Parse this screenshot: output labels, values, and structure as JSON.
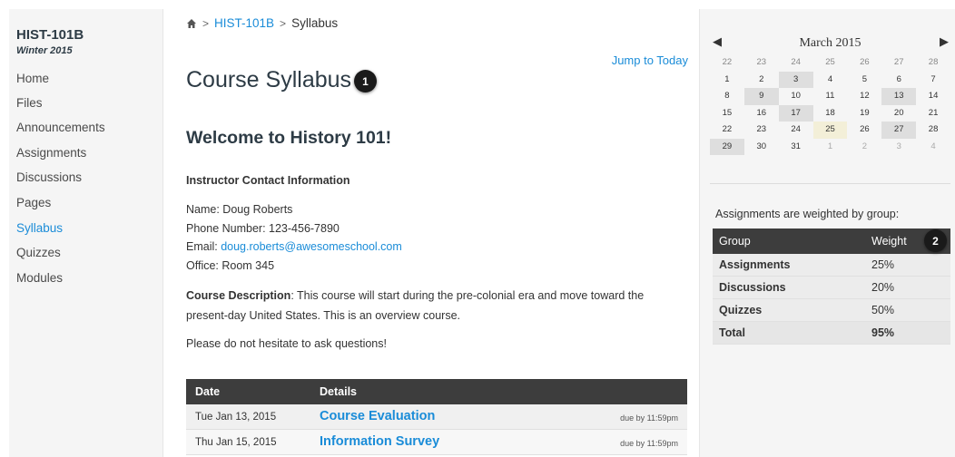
{
  "sidebar": {
    "course_code": "HIST-101B",
    "term": "Winter 2015",
    "items": [
      {
        "label": "Home",
        "active": false
      },
      {
        "label": "Files",
        "active": false
      },
      {
        "label": "Announcements",
        "active": false
      },
      {
        "label": "Assignments",
        "active": false
      },
      {
        "label": "Discussions",
        "active": false
      },
      {
        "label": "Pages",
        "active": false
      },
      {
        "label": "Syllabus",
        "active": true
      },
      {
        "label": "Quizzes",
        "active": false
      },
      {
        "label": "Modules",
        "active": false
      }
    ]
  },
  "breadcrumb": {
    "home_icon": "home-icon",
    "course": "HIST-101B",
    "current": "Syllabus"
  },
  "main": {
    "jump_to_today": "Jump to Today",
    "title": "Course Syllabus",
    "callout_1": "1",
    "welcome": "Welcome to History 101!",
    "contact_heading": "Instructor Contact Information",
    "name_line": "Name: Doug Roberts",
    "phone_line": "Phone Number: 123-456-7890",
    "email_prefix": "Email: ",
    "email": "doug.roberts@awesomeschool.com",
    "office_line": "Office: Room 345",
    "description_label": "Course Description",
    "description_line1": ": This course will start during the pre-colonial era and move toward the",
    "description_line2": "present-day United States. This is an overview course.",
    "hesitate": "Please do not hesitate to ask questions!"
  },
  "syllabus_table": {
    "headers": {
      "date": "Date",
      "details": "Details"
    },
    "rows": [
      {
        "date": "Tue Jan 13, 2015",
        "name": "Course Evaluation",
        "due": "due by 11:59pm"
      },
      {
        "date": "Thu Jan 15, 2015",
        "name": "Information Survey",
        "due": "due by 11:59pm"
      }
    ]
  },
  "calendar": {
    "month": "March 2015",
    "prev_icon": "chevron-left-icon",
    "next_icon": "chevron-right-icon",
    "header_row": [
      "22",
      "23",
      "24",
      "25",
      "26",
      "27",
      "28"
    ],
    "weeks": [
      [
        {
          "d": "1"
        },
        {
          "d": "2"
        },
        {
          "d": "3",
          "event": true
        },
        {
          "d": "4"
        },
        {
          "d": "5"
        },
        {
          "d": "6"
        },
        {
          "d": "7"
        }
      ],
      [
        {
          "d": "8"
        },
        {
          "d": "9",
          "event": true
        },
        {
          "d": "10"
        },
        {
          "d": "11"
        },
        {
          "d": "12"
        },
        {
          "d": "13",
          "event": true
        },
        {
          "d": "14"
        }
      ],
      [
        {
          "d": "15"
        },
        {
          "d": "16"
        },
        {
          "d": "17",
          "event": true
        },
        {
          "d": "18"
        },
        {
          "d": "19"
        },
        {
          "d": "20"
        },
        {
          "d": "21"
        }
      ],
      [
        {
          "d": "22"
        },
        {
          "d": "23"
        },
        {
          "d": "24"
        },
        {
          "d": "25",
          "today": true
        },
        {
          "d": "26"
        },
        {
          "d": "27",
          "event": true
        },
        {
          "d": "28"
        }
      ],
      [
        {
          "d": "29",
          "event": true
        },
        {
          "d": "30"
        },
        {
          "d": "31"
        },
        {
          "d": "1",
          "out": true
        },
        {
          "d": "2",
          "out": true
        },
        {
          "d": "3",
          "out": true
        },
        {
          "d": "4",
          "out": true
        }
      ]
    ]
  },
  "weights": {
    "caption": "Assignments are weighted by group:",
    "headers": {
      "group": "Group",
      "weight": "Weight"
    },
    "callout_2": "2",
    "rows": [
      {
        "group": "Assignments",
        "weight": "25%"
      },
      {
        "group": "Discussions",
        "weight": "20%"
      },
      {
        "group": "Quizzes",
        "weight": "50%"
      }
    ],
    "total": {
      "group": "Total",
      "weight": "95%"
    }
  },
  "colors": {
    "link": "#1a8cd8",
    "table_header": "#3d3d3d",
    "sidebar_bg": "#f5f5f5",
    "today": "#f3efd8",
    "event": "#dedede"
  }
}
